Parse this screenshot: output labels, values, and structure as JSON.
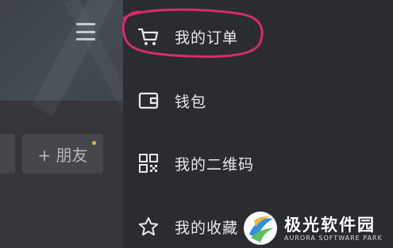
{
  "header": {
    "menu_icon": "hamburger-menu-icon"
  },
  "left": {
    "add_friend_label": "+ 朋友",
    "notification_dot_color": "#e3b94b"
  },
  "menu": {
    "items": [
      {
        "icon": "shopping-cart-icon",
        "label": "我的订单"
      },
      {
        "icon": "wallet-icon",
        "label": "钱包"
      },
      {
        "icon": "qr-code-icon",
        "label": "我的二维码"
      },
      {
        "icon": "star-icon",
        "label": "我的收藏"
      }
    ],
    "highlight_color": "#d62d67"
  },
  "watermark": {
    "title": "极光软件园",
    "subtitle": "AURORA SOFTWARE PARK"
  }
}
